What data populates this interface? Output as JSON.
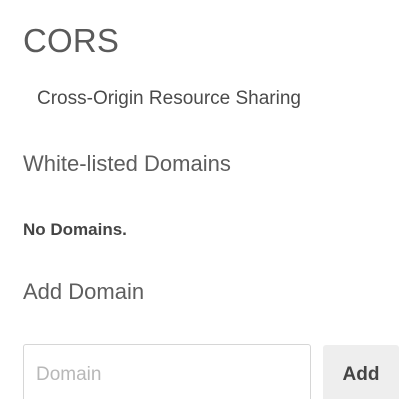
{
  "cors": {
    "title": "CORS",
    "subtitle": "Cross-Origin Resource Sharing",
    "whitelist": {
      "heading": "White-listed Domains",
      "empty_message": "No Domains."
    },
    "add_domain": {
      "heading": "Add Domain",
      "input": {
        "value": "",
        "placeholder": "Domain"
      },
      "button_label": "Add"
    }
  }
}
